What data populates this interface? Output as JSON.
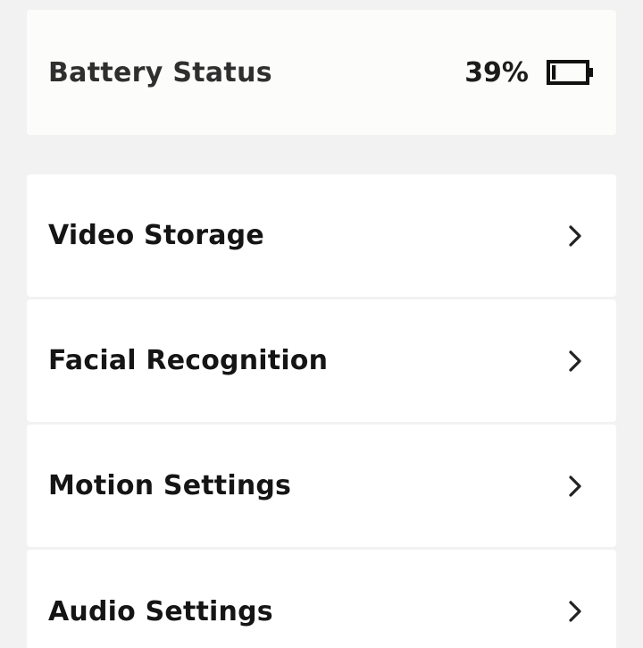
{
  "battery": {
    "label": "Battery Status",
    "value": "39%",
    "level": 0.39,
    "icon": "battery-icon"
  },
  "settings_items": [
    {
      "label": "Video Storage",
      "icon": "chevron-right-icon"
    },
    {
      "label": "Facial Recognition",
      "icon": "chevron-right-icon"
    },
    {
      "label": "Motion Settings",
      "icon": "chevron-right-icon"
    },
    {
      "label": "Audio Settings",
      "icon": "chevron-right-icon"
    }
  ],
  "colors": {
    "page_background": "#f2f2f2",
    "card_background": "#ffffff",
    "text": "#151515"
  }
}
